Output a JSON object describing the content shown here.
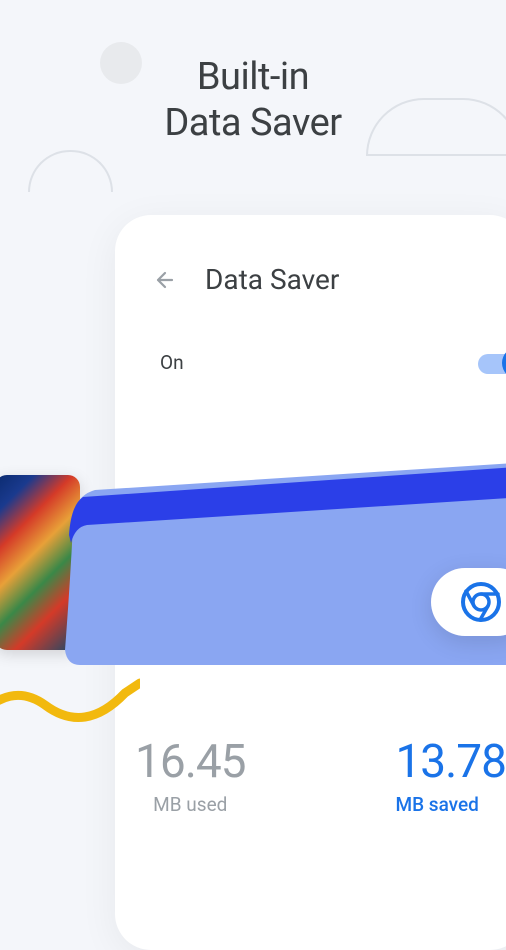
{
  "hero": {
    "title_line1": "Built-in",
    "title_line2": "Data Saver"
  },
  "card": {
    "title": "Data Saver",
    "toggle_label": "On",
    "toggle_state": true
  },
  "stats": {
    "used_value": "16.45",
    "used_label": "MB used",
    "saved_value": "13.78",
    "saved_label": "MB saved"
  },
  "icons": {
    "back": "arrow-left-icon",
    "chrome": "chrome-icon"
  },
  "colors": {
    "accent": "#1a73e8",
    "muted": "#9aa0a6"
  }
}
